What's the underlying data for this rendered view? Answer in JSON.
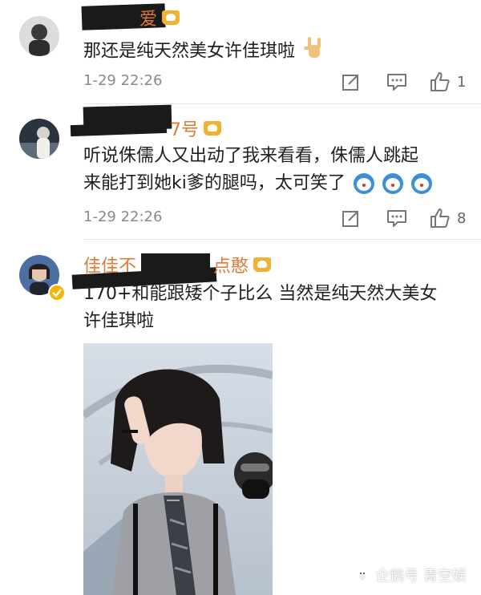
{
  "comments": [
    {
      "name_visible": "爱",
      "text": "那还是纯天然美女许佳琪啦",
      "time": "1-29 22:26",
      "likes": "1"
    },
    {
      "name_visible": "7号",
      "text_line1": "听说侏儒人又出动了我来看看，侏儒人跳起",
      "text_line2": "来能打到她ki爹的腿吗，太可笑了",
      "time": "1-29 22:26",
      "likes": "8"
    },
    {
      "name_visible_left": "佳佳不",
      "name_visible_right": "点憨",
      "text_line1": "170+和能跟矮个子比么 当然是纯天然大美女",
      "text_line2": "许佳琪啦"
    }
  ],
  "watermark": "企鹅号 青空娱",
  "icons": {
    "share": "share-icon",
    "reply": "comment-icon",
    "like": "thumbs-up-icon",
    "badge": "crown-badge-icon",
    "emoji": "doraemon-emoji-icon",
    "hand": "rock-hand-emoji-icon",
    "verified": "verified-badge-icon"
  }
}
